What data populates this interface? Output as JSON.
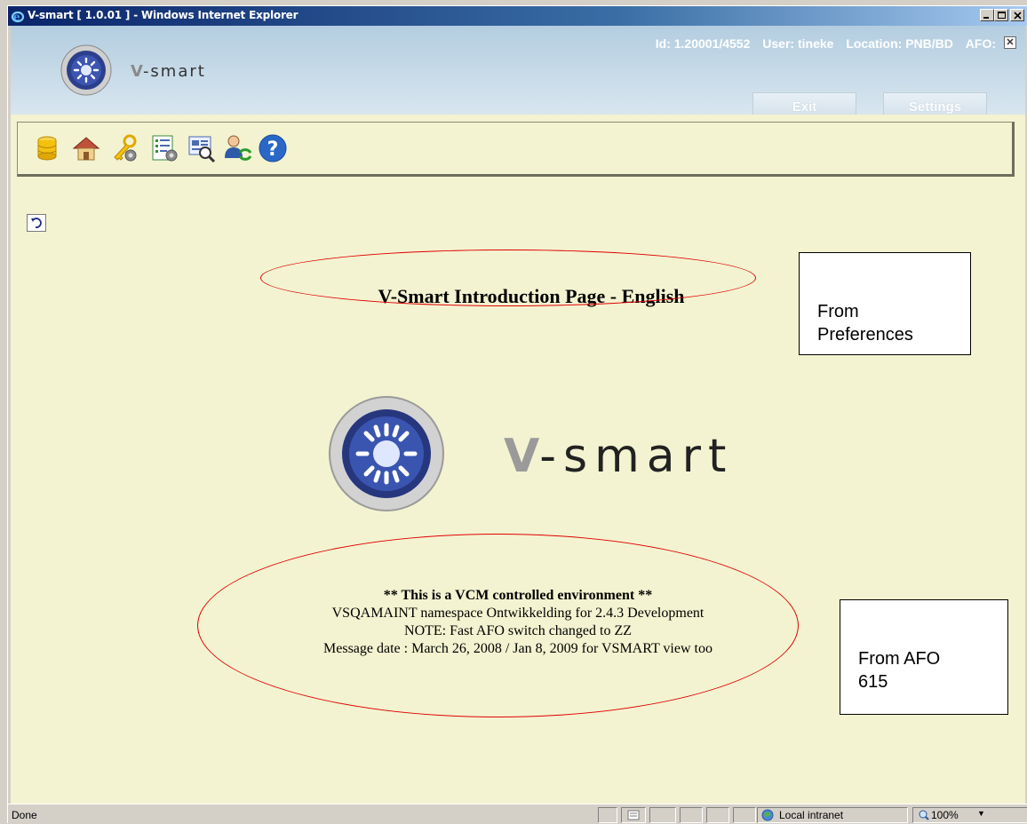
{
  "window": {
    "title": "V-smart [ 1.0.01 ] - Windows Internet Explorer"
  },
  "header": {
    "brand": "-smart",
    "brand_v": "V",
    "id": "Id: 1.20001/4552",
    "user": "User: tineke",
    "location": "Location: PNB/BD",
    "afo": "AFO:",
    "close_label": "✕",
    "exit_label": "Exit",
    "settings_label": "Settings"
  },
  "toolbar": {
    "icons": [
      "database-icon",
      "home-icon",
      "key-settings-icon",
      "list-settings-icon",
      "search-records-icon",
      "user-switch-icon",
      "help-icon"
    ]
  },
  "main": {
    "intro_title": "V-Smart Introduction Page - English",
    "big_brand_v": "V",
    "big_brand": "-smart",
    "messages": [
      "** This is a VCM controlled environment **",
      "VSQAMAINT namespace Ontwikkelding for 2.4.3 Development",
      "NOTE: Fast AFO switch changed to ZZ",
      "Message date : March 26, 2008 / Jan 8, 2009 for VSMART view too"
    ],
    "annotation_top_line1": "From",
    "annotation_top_line2": "Preferences",
    "annotation_bottom_line1": "From AFO",
    "annotation_bottom_line2": "615",
    "annotation_color": "#e00000"
  },
  "status": {
    "text": "Done",
    "zone": "Local intranet",
    "zoom": "100%"
  }
}
